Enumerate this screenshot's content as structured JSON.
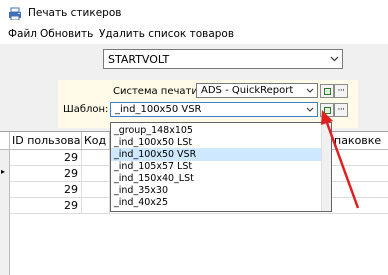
{
  "window": {
    "title": "Печать стикеров",
    "icon": "printer-app-icon"
  },
  "menu": [
    "Файл",
    "Обновить",
    "Удалить список товаров"
  ],
  "company_combo": {
    "value": "STARTVOLT"
  },
  "print_system": {
    "label": "Система печати:",
    "value": "ADS - QuickReport"
  },
  "template": {
    "label": "Шаблон:",
    "value": "_ind_100x50 VSR"
  },
  "dropdown": {
    "items": [
      "_group_148x105",
      "_ind_100x50 LSt",
      "_ind_100x50 VSR",
      "_ind_105x57 LSt",
      "_ind_150x40_LSt",
      "_ind_35x30",
      "_ind_40x25"
    ],
    "selected_index": 2
  },
  "grid": {
    "headers": [
      "ID пользова",
      "Код т",
      "паковке"
    ],
    "rows": [
      {
        "id": "29"
      },
      {
        "id": "29"
      },
      {
        "id": "29"
      },
      {
        "id": "29"
      }
    ],
    "row_indicator": "▸"
  },
  "annotation": {
    "color": "#e02020"
  }
}
